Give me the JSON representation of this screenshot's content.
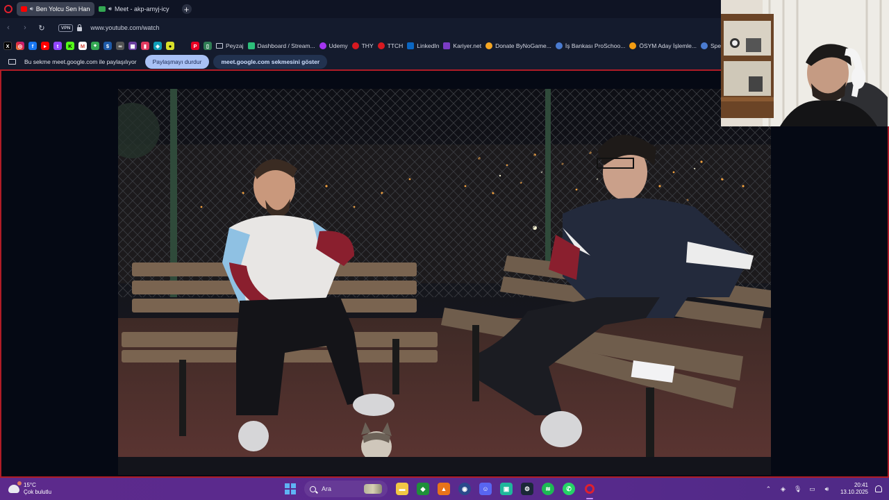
{
  "browser": {
    "tabs": [
      {
        "label": "Ben Yolcu Sen Hancı | ",
        "active": true,
        "audio": true,
        "favicon_color": "#ff0000"
      },
      {
        "label": "Meet - akp-amyj-icy",
        "active": false,
        "audio": true,
        "favicon_color": "#34a853"
      }
    ],
    "new_tab_icon": "plus-icon",
    "address": {
      "vpn_badge": "VPN",
      "url": "www.youtube.com/watch"
    },
    "bookmarks": [
      {
        "label": "Peyzaj",
        "icon": "folder-icon",
        "color": "#c9cedb"
      },
      {
        "label": "Dashboard / Stream...",
        "icon": "dashboard-icon",
        "color": "#2dbf7a"
      },
      {
        "label": "Udemy",
        "icon": "udemy-icon",
        "color": "#a435f0"
      },
      {
        "label": "THY",
        "icon": "thy-icon",
        "color": "#d71920"
      },
      {
        "label": "TTCH",
        "icon": "ttch-icon",
        "color": "#d71920"
      },
      {
        "label": "LinkedIn",
        "icon": "linkedin-icon",
        "color": "#0a66c2"
      },
      {
        "label": "Kariyer.net",
        "icon": "kariyer-icon",
        "color": "#7a3cc4"
      },
      {
        "label": "Donate ByNoGame...",
        "icon": "donate-icon",
        "color": "#f5a623"
      },
      {
        "label": "İş Bankası ProSchoo...",
        "icon": "isbank-icon",
        "color": "#4a7bd0"
      },
      {
        "label": "ÖSYM Aday İşlemle...",
        "icon": "osym-icon",
        "color": "#f39c12"
      },
      {
        "label": "Speak En",
        "icon": "speak-icon",
        "color": "#4a7bd0"
      }
    ],
    "share_bar": {
      "message": "Bu sekme meet.google.com ile paylaşılıyor",
      "stop_label": "Paylaşmayı durdur",
      "show_label": "meet.google.com sekmesini göster"
    }
  },
  "taskbar": {
    "weather_temp": "15°C",
    "weather_desc": "Çok bulutlu",
    "search_placeholder": "Ara",
    "time": "20:41",
    "date": "13.10.2025"
  }
}
